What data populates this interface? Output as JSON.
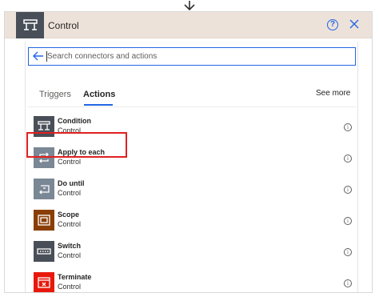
{
  "header": {
    "title": "Control",
    "help_icon": "help-icon",
    "close_icon": "close-icon",
    "background": "#ede2da",
    "icon_background": "#484f58"
  },
  "search": {
    "placeholder": "Search connectors and actions",
    "value": ""
  },
  "tabs": [
    {
      "label": "Triggers",
      "selected": false
    },
    {
      "label": "Actions",
      "selected": true
    }
  ],
  "see_more": "See more",
  "actions": [
    {
      "name": "Condition",
      "connector": "Control",
      "icon": "condition-icon",
      "color": "#484f58"
    },
    {
      "name": "Apply to each",
      "connector": "Control",
      "icon": "apply-to-each-icon",
      "color": "#7a8794",
      "highlighted": true
    },
    {
      "name": "Do until",
      "connector": "Control",
      "icon": "do-until-icon",
      "color": "#7a8794"
    },
    {
      "name": "Scope",
      "connector": "Control",
      "icon": "scope-icon",
      "color": "#8a3e06"
    },
    {
      "name": "Switch",
      "connector": "Control",
      "icon": "switch-icon",
      "color": "#484f58"
    },
    {
      "name": "Terminate",
      "connector": "Control",
      "icon": "terminate-icon",
      "color": "#e8180c"
    }
  ],
  "highlight_color": "#e02020",
  "accent_color": "#2266e3"
}
